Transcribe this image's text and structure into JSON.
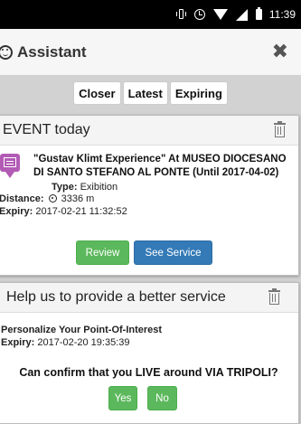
{
  "status_bar": {
    "time": "11:39",
    "icons": [
      "vibrate-icon",
      "alarm-icon",
      "wifi-icon",
      "signal-icon",
      "battery-icon"
    ]
  },
  "header": {
    "title": "Assistant",
    "icon": "smiley-icon",
    "close_icon": "close-icon",
    "close_glyph": "✖"
  },
  "filters": {
    "closer": "Closer",
    "latest": "Latest",
    "expiring": "Expiring"
  },
  "event_card": {
    "heading": "EVENT today",
    "title": "\"Gustav Klimt Experience\" At MUSEO DIOCESANO DI SANTO STEFANO AL PONTE (Until 2017-04-02)",
    "type_label": "Type:",
    "type_value": "Exibition",
    "distance_label": "Distance:",
    "distance_value": "3336 m",
    "expiry_label": "Expiry:",
    "expiry_value": "2017-02-21 11:32:52",
    "review_label": "Review",
    "see_service_label": "See Service"
  },
  "help_card": {
    "heading": "Help us to provide a better service",
    "subtitle": "Personalize Your Point-Of-Interest",
    "expiry_label": "Expiry:",
    "expiry_value": "2017-02-20 19:35:39",
    "question": "Can confirm that you LIVE around VIA TRIPOLI?",
    "yes_label": "Yes",
    "no_label": "No"
  },
  "colors": {
    "green": "#5cb85c",
    "blue": "#337ab7",
    "event_icon": "#b25bb5",
    "background": "#d2d2d2"
  }
}
